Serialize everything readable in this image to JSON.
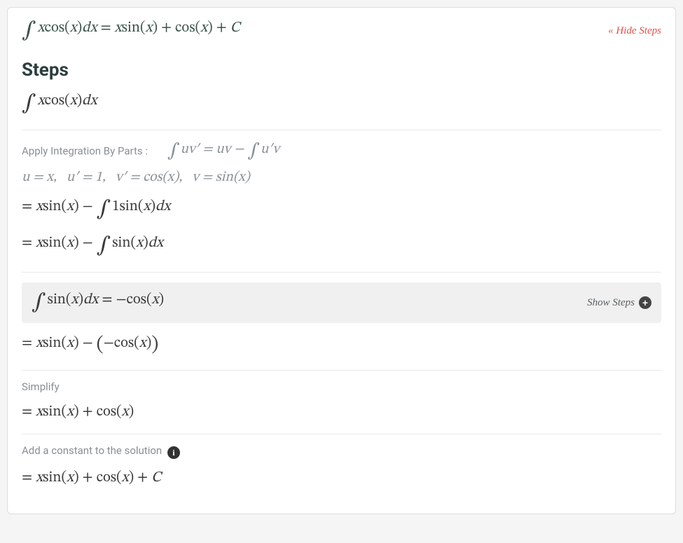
{
  "header": {
    "answer_math": "∫ x cos(x) dx = x sin(x) + cos(x) + C",
    "hide_label": "« Hide Steps"
  },
  "steps_heading": "Steps",
  "original_integral": "∫ x cos(x) dx",
  "byparts": {
    "hint_label": "Apply Integration By Parts :",
    "rule_math": "∫ uv′ = uv − ∫ u′v",
    "vars_math": "u = x,  u′ = 1,  v′ = cos(x),  v = sin(x)",
    "line1_math": "= x sin(x) − ∫ 1·sin(x) dx",
    "line2_math": "= x sin(x) − ∫ sin(x) dx"
  },
  "substep": {
    "result_math": "∫ sin(x) dx = −cos(x)",
    "show_label": "Show Steps"
  },
  "after_sub_math": "= x sin(x) − (−cos(x))",
  "simplify": {
    "hint_label": "Simplify",
    "result_math": "= x sin(x) + cos(x)"
  },
  "finalize": {
    "hint_label": "Add a constant to the solution",
    "result_math": "= x sin(x) + cos(x) + C"
  }
}
